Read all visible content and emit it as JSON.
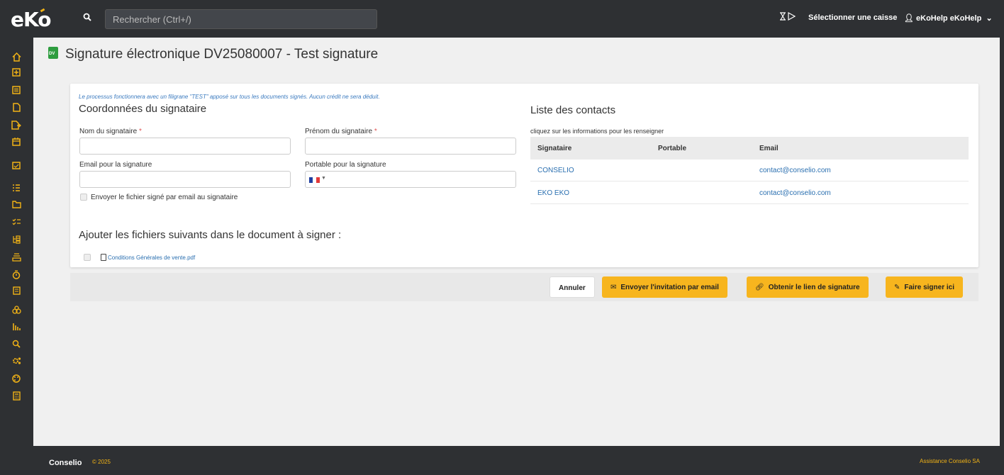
{
  "header": {
    "logo": "eko",
    "search_placeholder": "Rechercher (Ctrl+/)",
    "caisse_label": "Sélectionner une caisse",
    "user_label": "eKoHelp eKoHelp"
  },
  "page": {
    "title": "Signature électronique DV25080007 - Test signature"
  },
  "form": {
    "notice": "Le processus fonctionnera avec un filigrane \"TEST\" apposé sur tous les documents signés. Aucun crédit ne sera déduit.",
    "section_title": "Coordonnées du signataire",
    "nom_label": "Nom du signataire",
    "prenom_label": "Prénom du signataire",
    "email_label": "Email pour la signature",
    "portable_label": "Portable pour la signature",
    "send_copy_label": "Envoyer le fichier signé par email au signataire",
    "required_mark": "*"
  },
  "contacts": {
    "title": "Liste des contacts",
    "hint": "cliquez sur les informations pour les renseigner",
    "columns": [
      "Signataire",
      "Portable",
      "Email"
    ],
    "rows": [
      {
        "signataire": "CONSELIO",
        "portable": "",
        "email": "contact@conselio.com"
      },
      {
        "signataire": "EKO EKO",
        "portable": "",
        "email": "contact@conselio.com"
      }
    ]
  },
  "attachments": {
    "title": "Ajouter les fichiers suivants dans le document à signer :",
    "files": [
      "Conditions Générales de vente.pdf"
    ]
  },
  "actions": {
    "cancel": "Annuler",
    "send_email": "Envoyer l'invitation par email",
    "get_link": "Obtenir le lien de signature",
    "sign_here": "Faire signer ici"
  },
  "footer": {
    "brand": "Conselio",
    "year": "© 2025",
    "assistance": "Assistance Conselio SA"
  },
  "colors": {
    "accent": "#f7b51e",
    "dark": "#2e3033",
    "link": "#2a6fb0",
    "title_icon": "#2e9d3f"
  },
  "sidebar_icons": [
    "home-icon",
    "plus-square-icon",
    "list-icon",
    "file-icon",
    "file-export-icon",
    "calendar-icon",
    "calendar-check-icon",
    "tasks-icon",
    "folder-icon",
    "checklist-icon",
    "tree-icon",
    "inbox-icon",
    "stopwatch-icon",
    "document-icon",
    "sitemap-icon",
    "bar-chart-icon",
    "search-icon",
    "settings-icon",
    "palette-icon",
    "calculator-icon"
  ]
}
